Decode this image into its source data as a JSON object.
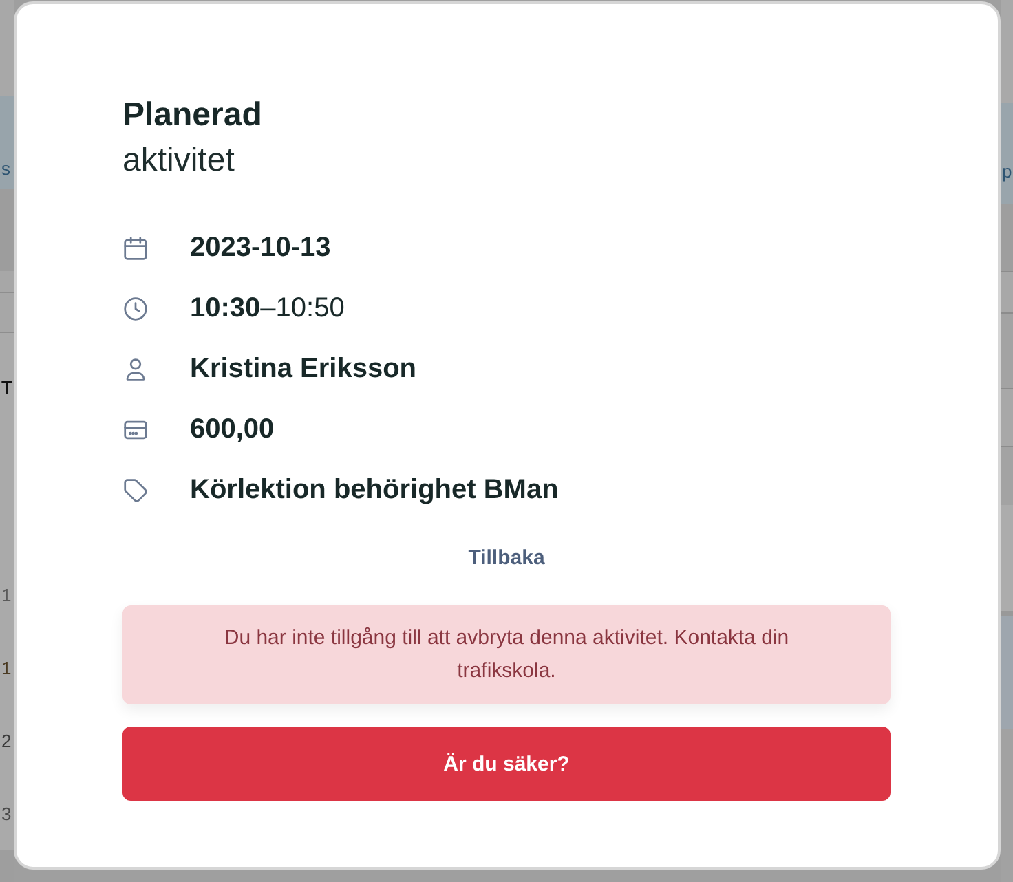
{
  "background": {
    "left_fragments": [
      "s",
      "T",
      "1",
      "1",
      "2",
      "3"
    ],
    "right_fragments": [
      "p"
    ]
  },
  "modal": {
    "title": "Planerad",
    "subtitle": "aktivitet",
    "details": [
      {
        "kind": "date",
        "text": "2023-10-13"
      },
      {
        "kind": "time",
        "text": "**10:30**–10:50"
      },
      {
        "kind": "person",
        "text": "Kristina Eriksson"
      },
      {
        "kind": "price",
        "text": "600,00"
      },
      {
        "kind": "tag",
        "text": "Körlektion behörighet BMan"
      }
    ],
    "back_link": "Tillbaka",
    "alert": {
      "text": "Du har inte tillgång till att avbryta denna aktivitet. Kontakta din trafikskola."
    },
    "confirm_button": "Är du säker?"
  }
}
